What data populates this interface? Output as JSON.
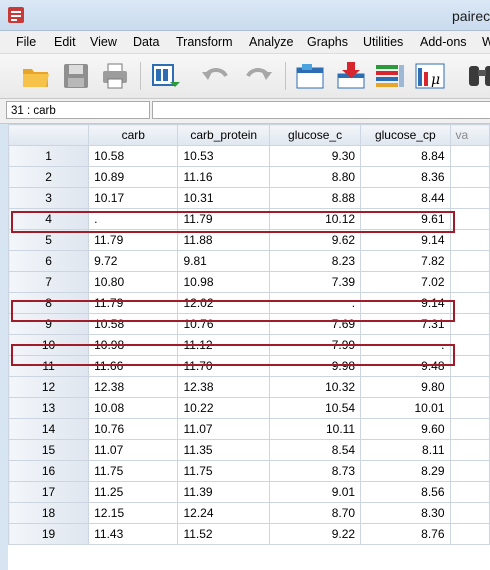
{
  "window": {
    "title": "pairec"
  },
  "menu": [
    "File",
    "Edit",
    "View",
    "Data",
    "Transform",
    "Analyze",
    "Graphs",
    "Utilities",
    "Add-ons",
    "W"
  ],
  "toolbar": {
    "icons": [
      "open-folder-icon",
      "save-icon",
      "print-icon",
      "dialog-recall-icon",
      "undo-icon",
      "redo-icon",
      "goto-case-icon",
      "goto-variable-icon",
      "variables-icon",
      "run-descriptive-icon",
      "binoculars-icon"
    ]
  },
  "cell_reference": {
    "label": "31 : carb",
    "value": ""
  },
  "grid": {
    "columns": [
      "carb",
      "carb_protein",
      "glucose_c",
      "glucose_cp",
      "va"
    ],
    "rows": [
      {
        "n": "1",
        "carb": "10.58",
        "carb_protein": "10.53",
        "glucose_c": "9.30",
        "glucose_cp": "8.84"
      },
      {
        "n": "2",
        "carb": "10.89",
        "carb_protein": "11.16",
        "glucose_c": "8.80",
        "glucose_cp": "8.36"
      },
      {
        "n": "3",
        "carb": "10.17",
        "carb_protein": "10.31",
        "glucose_c": "8.88",
        "glucose_cp": "8.44"
      },
      {
        "n": "4",
        "carb": ".",
        "carb_protein": "11.79",
        "glucose_c": "10.12",
        "glucose_cp": "9.61"
      },
      {
        "n": "5",
        "carb": "11.79",
        "carb_protein": "11.88",
        "glucose_c": "9.62",
        "glucose_cp": "9.14"
      },
      {
        "n": "6",
        "carb": "9.72",
        "carb_protein": "9.81",
        "glucose_c": "8.23",
        "glucose_cp": "7.82"
      },
      {
        "n": "7",
        "carb": "10.80",
        "carb_protein": "10.98",
        "glucose_c": "7.39",
        "glucose_cp": "7.02"
      },
      {
        "n": "8",
        "carb": "11.79",
        "carb_protein": "12.02",
        "glucose_c": ".",
        "glucose_cp": "9.14"
      },
      {
        "n": "9",
        "carb": "10.58",
        "carb_protein": "10.76",
        "glucose_c": "7.69",
        "glucose_cp": "7.31"
      },
      {
        "n": "10",
        "carb": "10.98",
        "carb_protein": "11.12",
        "glucose_c": "7.99",
        "glucose_cp": "."
      },
      {
        "n": "11",
        "carb": "11.66",
        "carb_protein": "11.70",
        "glucose_c": "9.98",
        "glucose_cp": "9.48"
      },
      {
        "n": "12",
        "carb": "12.38",
        "carb_protein": "12.38",
        "glucose_c": "10.32",
        "glucose_cp": "9.80"
      },
      {
        "n": "13",
        "carb": "10.08",
        "carb_protein": "10.22",
        "glucose_c": "10.54",
        "glucose_cp": "10.01"
      },
      {
        "n": "14",
        "carb": "10.76",
        "carb_protein": "11.07",
        "glucose_c": "10.11",
        "glucose_cp": "9.60"
      },
      {
        "n": "15",
        "carb": "11.07",
        "carb_protein": "11.35",
        "glucose_c": "8.54",
        "glucose_cp": "8.11"
      },
      {
        "n": "16",
        "carb": "11.75",
        "carb_protein": "11.75",
        "glucose_c": "8.73",
        "glucose_cp": "8.29"
      },
      {
        "n": "17",
        "carb": "11.25",
        "carb_protein": "11.39",
        "glucose_c": "9.01",
        "glucose_cp": "8.56"
      },
      {
        "n": "18",
        "carb": "12.15",
        "carb_protein": "12.24",
        "glucose_c": "8.70",
        "glucose_cp": "8.30"
      },
      {
        "n": "19",
        "carb": "11.43",
        "carb_protein": "11.52",
        "glucose_c": "9.22",
        "glucose_cp": "8.76"
      }
    ],
    "highlighted_rows": [
      "4",
      "8",
      "10"
    ]
  },
  "colors": {
    "highlight_border": "#a01c28",
    "header_bg": "#dfe6ef"
  }
}
